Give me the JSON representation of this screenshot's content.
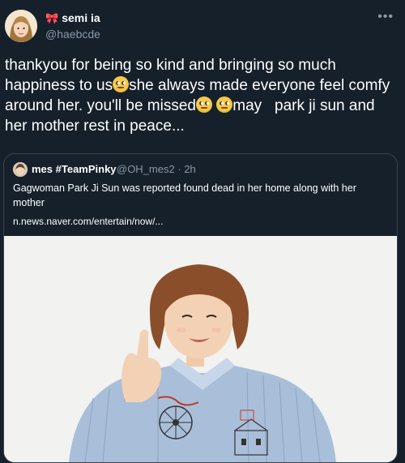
{
  "user": {
    "display_name": "semi ia",
    "handle": "@haebcde",
    "badge_icon": "ribbon-icon"
  },
  "tweet": {
    "segments": [
      "thankyou for being so kind and bringing so much happiness to us",
      "she always made everyone feel comfy around her. you'll be missed",
      "may   park ji sun and her mother rest in peace..."
    ],
    "emoji_icon": "face-with-rolling-eyes-emoji"
  },
  "quote": {
    "display_name": "mes #TeamPinky",
    "handle": "@OH_mes2",
    "separator": "·",
    "time": "2h",
    "text": "Gagwoman Park Ji Sun was reported found dead in her home along with her mother",
    "link": "n.news.naver.com/entertain/now/..."
  },
  "colors": {
    "background": "#15202b",
    "border": "#38444d",
    "secondary_text": "#8899a6"
  }
}
